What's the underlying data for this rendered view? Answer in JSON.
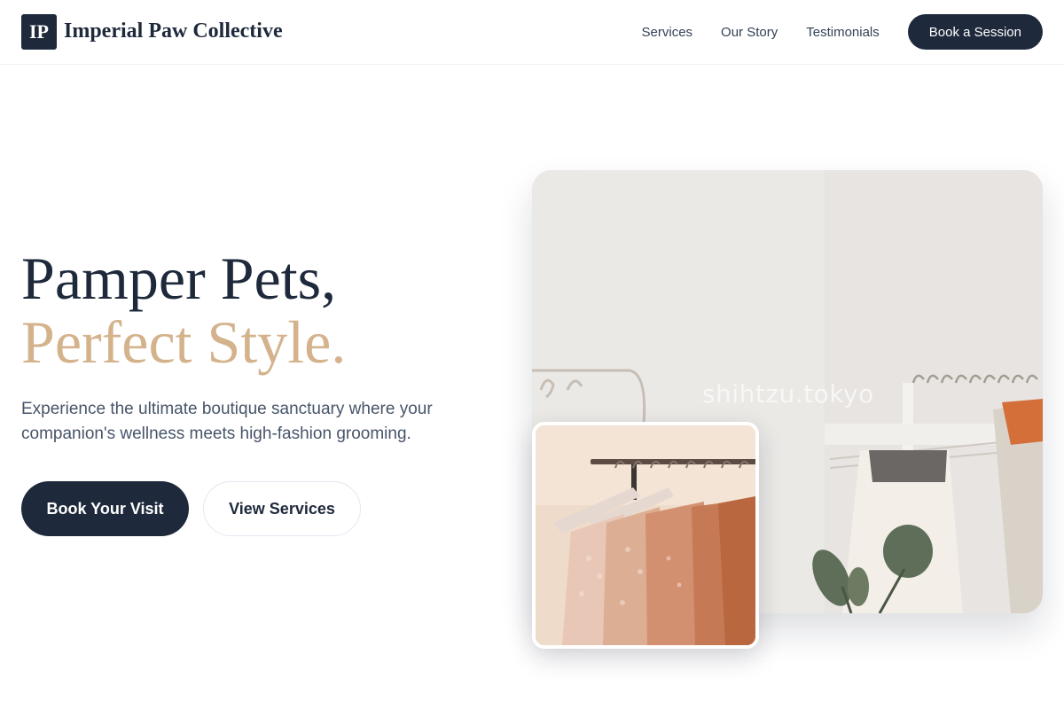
{
  "header": {
    "logo_mark": "IP",
    "brand": "Imperial Paw Collective",
    "nav": [
      {
        "label": "Services"
      },
      {
        "label": "Our Story"
      },
      {
        "label": "Testimonials"
      }
    ],
    "cta_label": "Book a Session"
  },
  "hero": {
    "title_line1": "Pamper Pets,",
    "title_line2": "Perfect Style.",
    "subtitle": "Experience the ultimate boutique sanctuary where your companion's wellness meets high-fashion grooming.",
    "primary_button": "Book Your Visit",
    "secondary_button": "View Services"
  },
  "images": {
    "main_watermark": "shihtzu.tokyo",
    "main_icon": "clothing-rack-photo",
    "inset_icon": "hanging-dresses-photo"
  },
  "colors": {
    "navy": "#1e293b",
    "gold": "#d4b38c",
    "text_muted": "#475569"
  }
}
